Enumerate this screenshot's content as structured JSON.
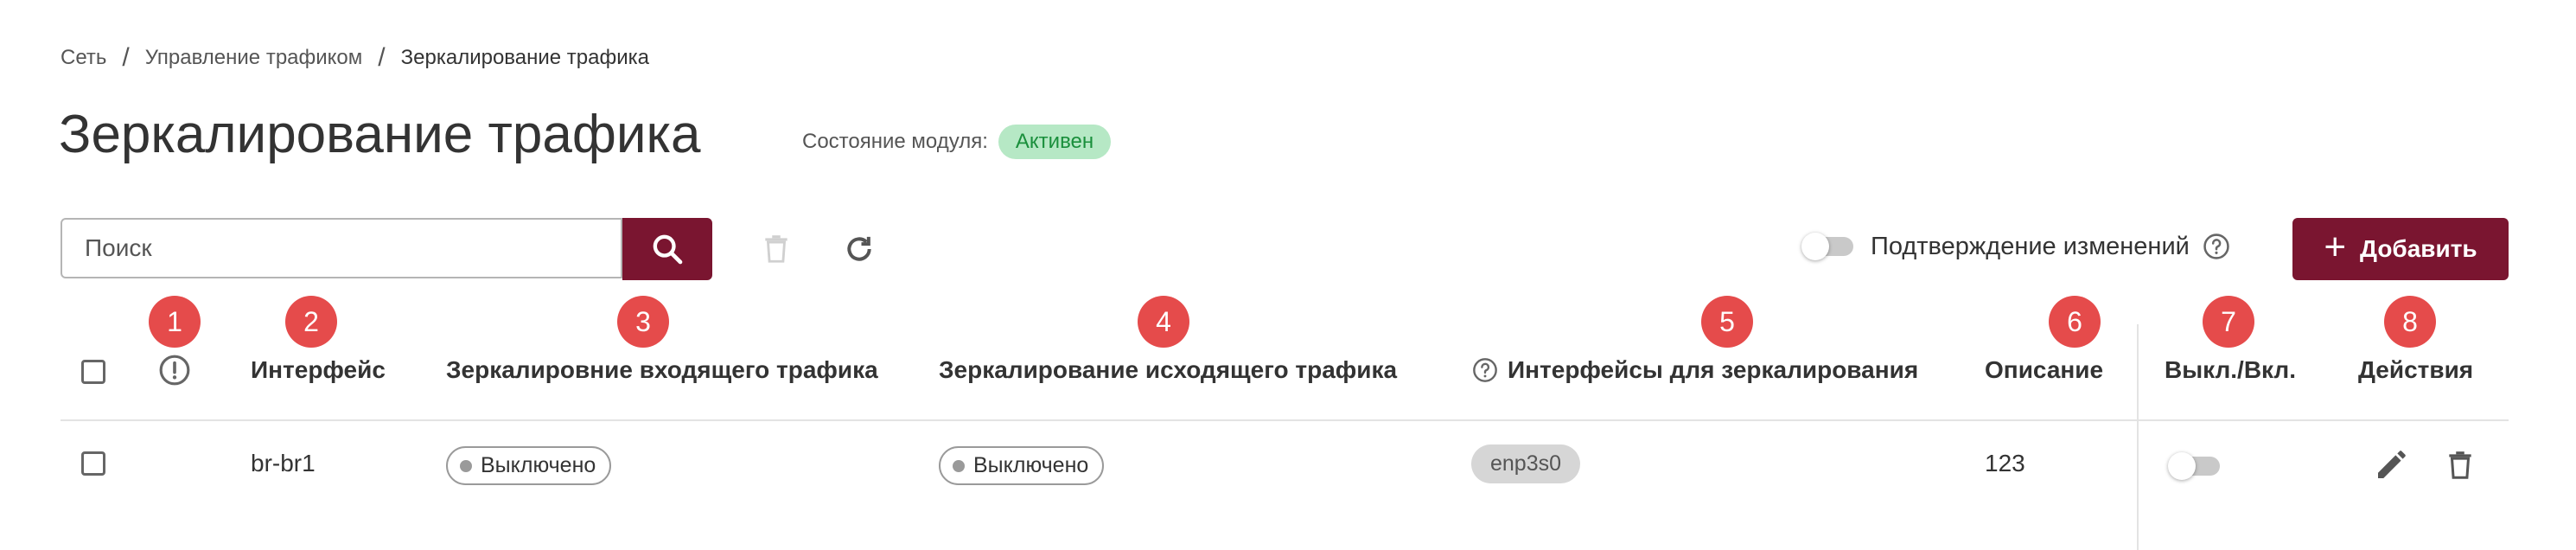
{
  "breadcrumb": [
    "Сеть",
    "Управление трафиком",
    "Зеркалирование трафика"
  ],
  "page_title": "Зеркалирование трафика",
  "module_state": {
    "label": "Состояние модуля:",
    "value": "Активен",
    "color": "#1a8f3c",
    "bg": "#b6e8c5"
  },
  "search": {
    "placeholder": "Поиск",
    "value": ""
  },
  "toolbar": {
    "confirm_label": "Подтверждение изменений",
    "confirm_enabled": false,
    "add_label": "Добавить"
  },
  "markers": [
    "1",
    "2",
    "3",
    "4",
    "5",
    "6",
    "7",
    "8"
  ],
  "columns": {
    "interface": "Интерфейс",
    "ingress": "Зеркалировние входящего трафика",
    "egress": "Зеркалирование исходящего трафика",
    "mirror_ifaces": "Интерфейсы для зеркалирования",
    "description": "Описание",
    "toggle": "Выкл./Вкл.",
    "actions": "Действия"
  },
  "rows": [
    {
      "interface": "br-br1",
      "ingress": "Выключено",
      "egress": "Выключено",
      "mirror_iface": "enp3s0",
      "description": "123",
      "enabled": false
    }
  ],
  "colors": {
    "accent": "#7a1530",
    "marker": "#e54b4b"
  },
  "icons": [
    "search-icon",
    "trash-icon",
    "refresh-icon",
    "help-icon",
    "alert-circle-icon",
    "plus-icon",
    "pencil-icon"
  ]
}
